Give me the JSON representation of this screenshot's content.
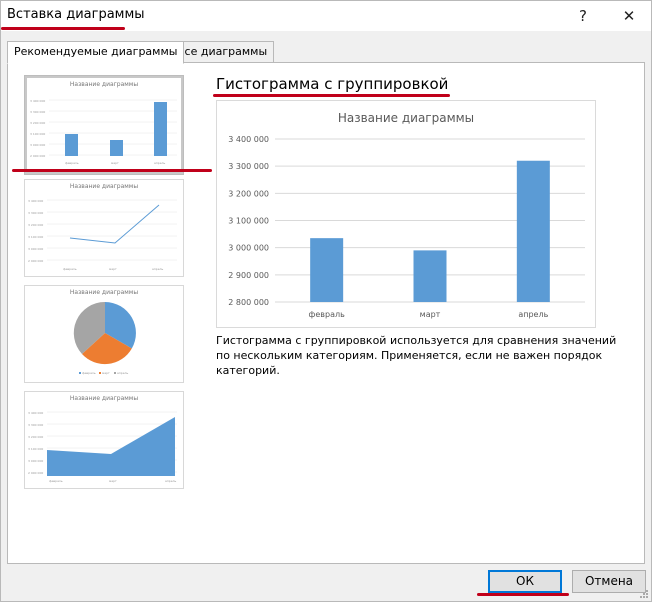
{
  "window": {
    "title": "Вставка диаграммы",
    "help_glyph": "?",
    "close_glyph": "✕"
  },
  "tabs": [
    {
      "label": "Рекомендуемые диаграммы",
      "active": true
    },
    {
      "label": "Все диаграммы",
      "active": false
    }
  ],
  "thumbnails": [
    {
      "name": "clustered-column",
      "title": "Название диаграммы",
      "selected": true
    },
    {
      "name": "line",
      "title": "Название диаграммы",
      "selected": false
    },
    {
      "name": "pie",
      "title": "Название диаграммы",
      "selected": false,
      "legend": [
        "февраль",
        "март",
        "апрель"
      ]
    },
    {
      "name": "area",
      "title": "Название диаграммы",
      "selected": false
    }
  ],
  "selected_chart": {
    "type_name": "Гистограмма с группировкой",
    "description": "Гистограмма с группировкой используется для сравнения значений по нескольким категориям. Применяется, если не важен порядок категорий."
  },
  "chart_data": {
    "type": "bar",
    "title": "Название диаграммы",
    "categories": [
      "февраль",
      "март",
      "апрель"
    ],
    "values": [
      3035000,
      2990000,
      3320000
    ],
    "ylim": [
      2800000,
      3400000
    ],
    "yticks": [
      "2 800 000",
      "2 900 000",
      "3 000 000",
      "3 100 000",
      "3 200 000",
      "3 300 000",
      "3 400 000"
    ],
    "grid": true,
    "bar_color": "#5b9bd5",
    "xlabel": "",
    "ylabel": ""
  },
  "pie_colors": [
    "#5b9bd5",
    "#ed7d31",
    "#a5a5a5"
  ],
  "footer": {
    "ok_label": "ОК",
    "cancel_label": "Отмена"
  },
  "accent": "#c0001a"
}
